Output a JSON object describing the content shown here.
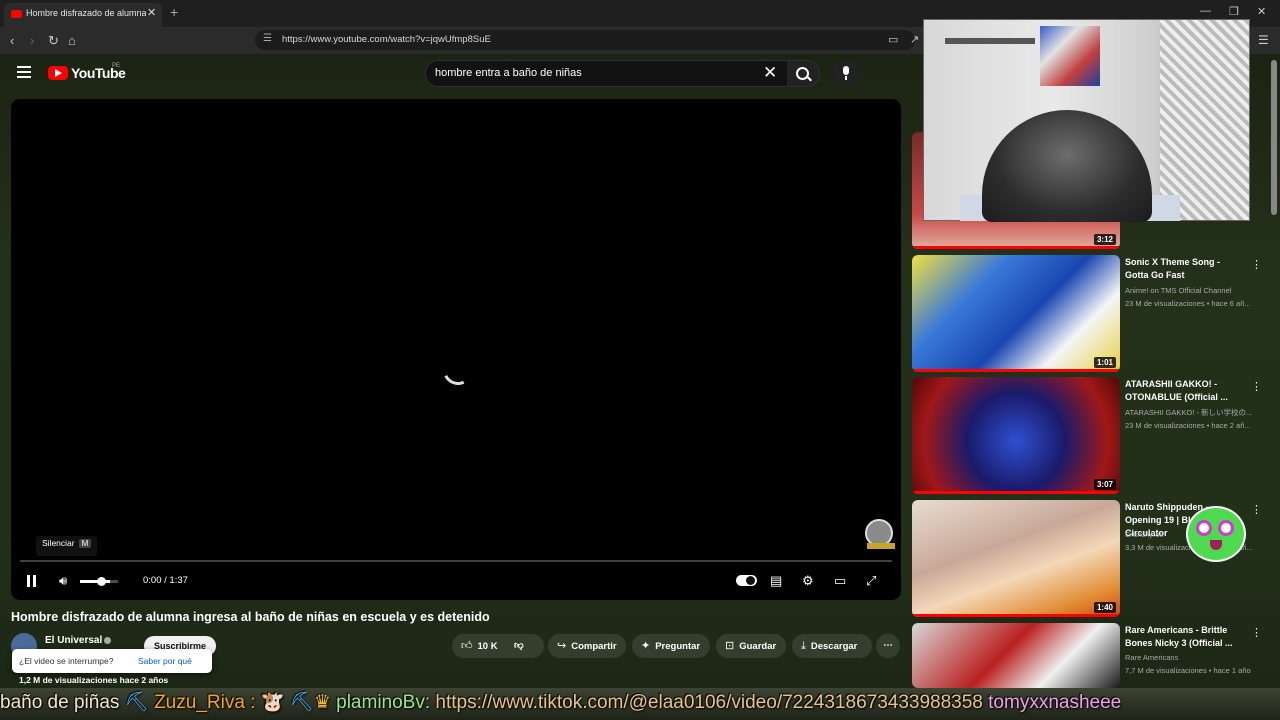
{
  "browser": {
    "tab_title": "Hombre disfrazado de alumna ir",
    "tab_close": "✕",
    "new_tab": "+",
    "url": "https://www.youtube.com/watch?v=jqwUfmp8SuE"
  },
  "youtube": {
    "logo_text": "YouTube",
    "country": "PE",
    "search_query": "hombre entra a baño de niñas",
    "clear": "✕"
  },
  "player": {
    "tooltip_label": "Silenciar",
    "tooltip_key": "M",
    "time": "0:00 / 1:37",
    "volume_level": 0.75
  },
  "video": {
    "title": "Hombre disfrazado de alumna ingresa al baño de niñas en escuela y es detenido",
    "channel": "El Universal",
    "subscribe": "Suscribirme",
    "popup_question": "¿El video se interrumpe?",
    "popup_link": "Saber por qué",
    "likes": "10 K",
    "share": "Compartir",
    "ask": "Preguntar",
    "save": "Guardar",
    "download": "Descargar",
    "views": "1,2 M de visualizaciones  hace 2 años"
  },
  "recommended": [
    {
      "title": "",
      "channel": "",
      "meta": "",
      "duration": "3:12"
    },
    {
      "title": "Sonic X Theme Song - Gotta Go Fast",
      "channel": "Anime! on TMS Official Channel",
      "meta": "23 M de visualizaciones • hace 6 añ...",
      "duration": "1:01"
    },
    {
      "title": "ATARASHII GAKKO! - OTONABLUE (Official ...",
      "channel": "ATARASHII GAKKO! - 新しい学校の...",
      "meta": "23 M de visualizaciones • hace 2 añ...",
      "duration": "3:07"
    },
    {
      "title": "Naruto Shippuden - Opening 19 | Blood Circulator",
      "channel": "Crunchyroll",
      "meta": "3,3 M de visualizaciones • hace 7 añ...",
      "duration": "1:40"
    },
    {
      "title": "Rare Americans - Brittle Bones Nicky 3 (Official ...",
      "channel": "Rare Americans",
      "meta": "7,7 M de visualizaciones • hace 1 año",
      "duration": ""
    }
  ],
  "ticker": {
    "t1": "baño de piñas",
    "t2": "Zuzu_Riva :",
    "t3": "plaminoBv:",
    "t4": "https://www.tiktok.com/@elaa0106/video/7224318673433988358",
    "t5": "tomyxxnasheee"
  }
}
